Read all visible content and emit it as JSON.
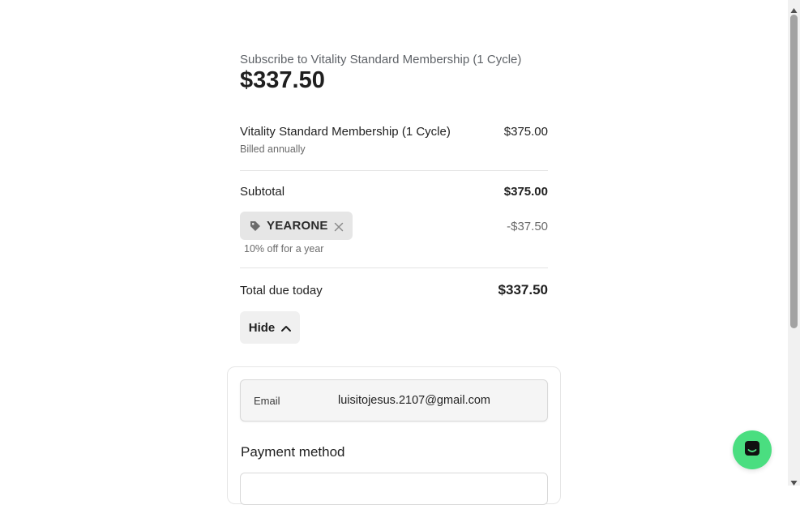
{
  "summary": {
    "subtitle": "Subscribe to Vitality Standard Membership (1 Cycle)",
    "total_amount": "$337.50"
  },
  "line_item": {
    "name": "Vitality Standard Membership (1 Cycle)",
    "price": "$375.00",
    "billing": "Billed annually"
  },
  "subtotal": {
    "label": "Subtotal",
    "value": "$375.00"
  },
  "promo": {
    "code": "YEARONE",
    "discount": "-$37.50",
    "description": "10% off for a year",
    "icon": "tag-icon",
    "remove_icon": "close-icon"
  },
  "total_due": {
    "label": "Total due today",
    "value": "$337.50"
  },
  "toggle_details": {
    "label": "Hide",
    "icon": "chevron-up-icon"
  },
  "contact": {
    "email_label": "Email",
    "email_value": "luisitojesus.2107@gmail.com"
  },
  "payment": {
    "heading": "Payment method"
  },
  "chat": {
    "icon": "chat-icon",
    "color": "#4ade80"
  }
}
